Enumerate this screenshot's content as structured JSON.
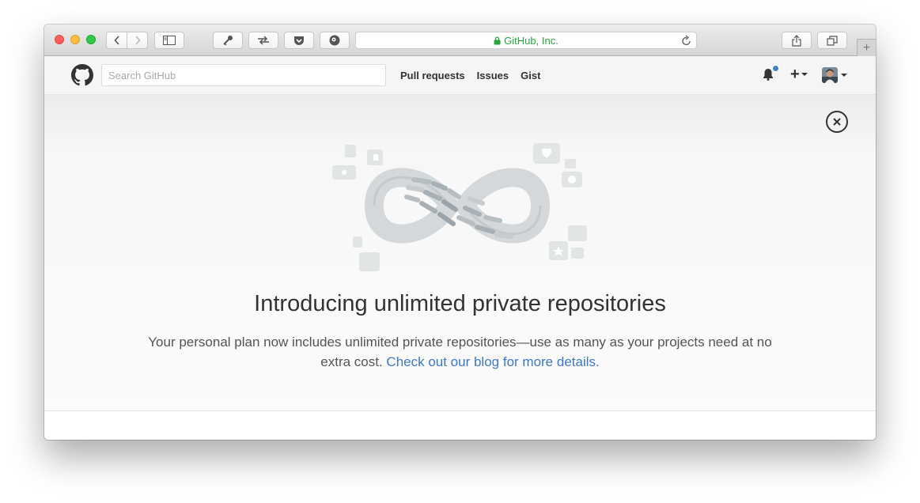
{
  "browser": {
    "address_text": "GitHub, Inc.",
    "new_tab_symbol": "+"
  },
  "header": {
    "search_placeholder": "Search GitHub",
    "nav": [
      "Pull requests",
      "Issues",
      "Gist"
    ],
    "plus_symbol": "+"
  },
  "announcement": {
    "title": "Introducing unlimited private repositories",
    "body": "Your personal plan now includes unlimited private repositories—use as many as your projects need at no extra cost.",
    "link_text": "Check out our blog for more details."
  },
  "colors": {
    "link": "#4078c0",
    "address_green": "#2aa441",
    "notification_dot": "#4183c4"
  }
}
